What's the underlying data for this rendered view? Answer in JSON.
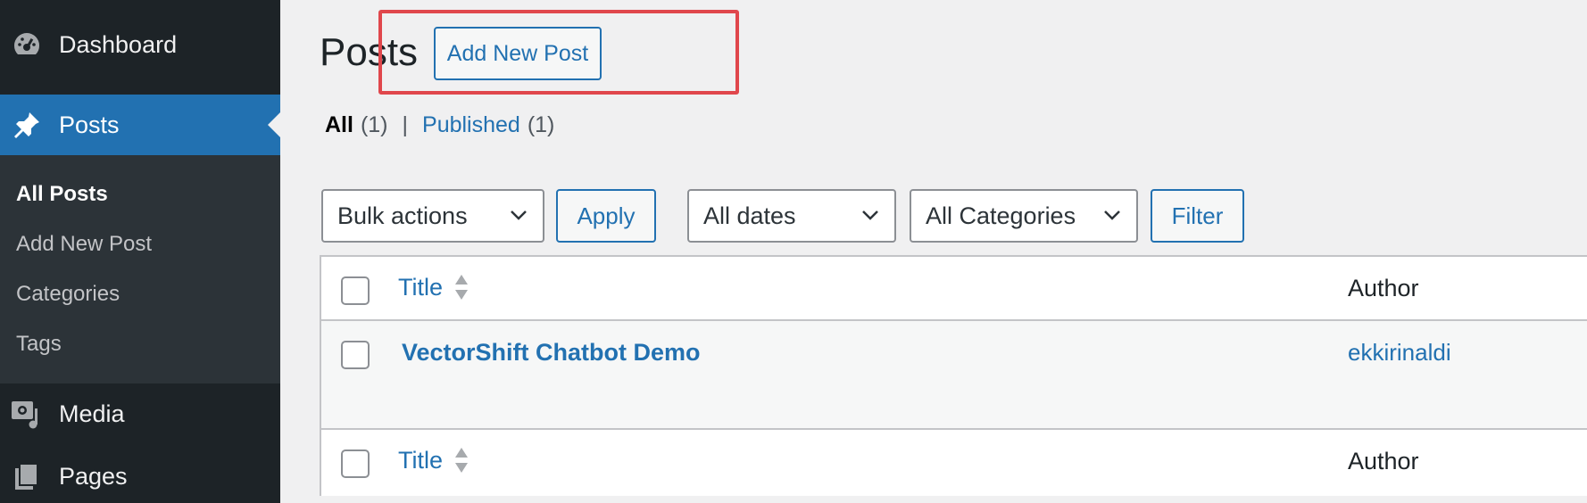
{
  "sidebar": {
    "items": [
      {
        "label": "Dashboard",
        "icon": "dashboard-icon"
      },
      {
        "label": "Posts",
        "icon": "pin-icon"
      },
      {
        "label": "Media",
        "icon": "media-icon"
      },
      {
        "label": "Pages",
        "icon": "pages-icon"
      }
    ],
    "submenu": [
      {
        "label": "All Posts"
      },
      {
        "label": "Add New Post"
      },
      {
        "label": "Categories"
      },
      {
        "label": "Tags"
      }
    ]
  },
  "header": {
    "title": "Posts",
    "add_new_label": "Add New Post"
  },
  "filters": {
    "all_label": "All",
    "all_count": "(1)",
    "separator": "|",
    "published_label": "Published",
    "published_count": "(1)"
  },
  "toolbar": {
    "bulk_actions": "Bulk actions",
    "apply": "Apply",
    "dates": "All dates",
    "categories": "All Categories",
    "filter": "Filter"
  },
  "table": {
    "columns": {
      "title": "Title",
      "author": "Author"
    },
    "rows": [
      {
        "title": "VectorShift Chatbot Demo",
        "author": "ekkirinaldi"
      }
    ]
  },
  "colors": {
    "sidebar_bg": "#1d2327",
    "accent": "#2271b1",
    "highlight": "#e0474c"
  }
}
